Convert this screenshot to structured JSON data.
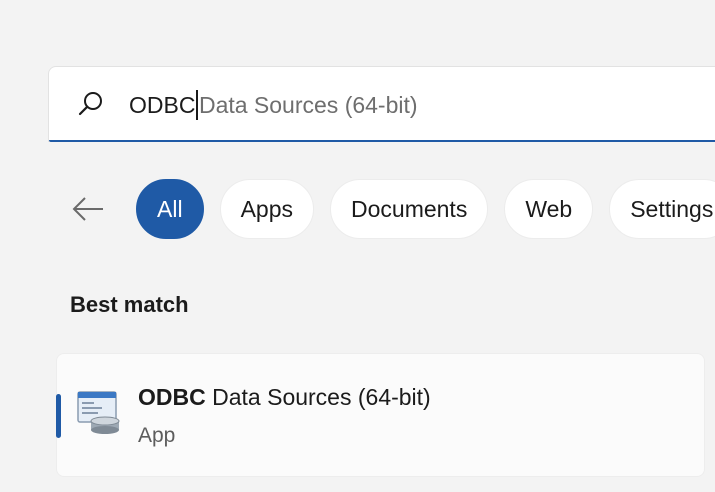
{
  "search": {
    "typed": "ODBC",
    "suggestion": "Data Sources (64-bit)"
  },
  "filters": {
    "back_icon": "arrow-left-icon",
    "chips": [
      "All",
      "Apps",
      "Documents",
      "Web",
      "Settings"
    ]
  },
  "best_match": {
    "heading": "Best match",
    "result": {
      "title_bold": "ODBC",
      "title_rest": " Data Sources (64-bit)",
      "subtitle": "App",
      "icon": "odbc-datasource-icon"
    }
  },
  "colors": {
    "accent": "#1f5aa6",
    "background": "#f3f3f3"
  }
}
